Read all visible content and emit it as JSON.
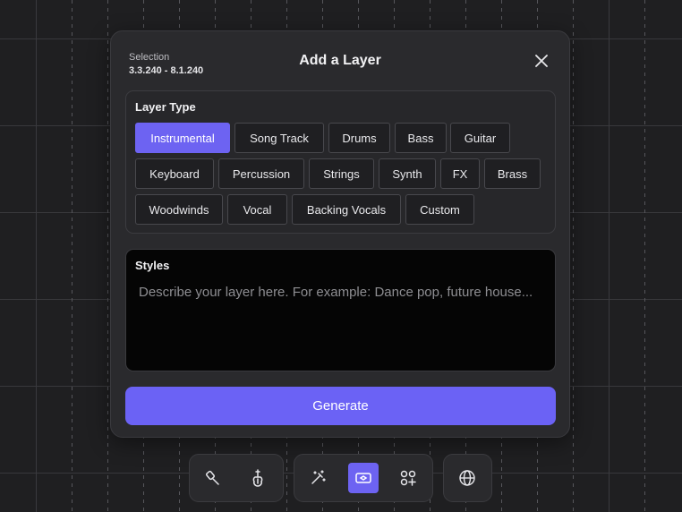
{
  "dialog": {
    "selection_label": "Selection",
    "selection_range": "3.3.240 - 8.1.240",
    "title": "Add a Layer",
    "close_icon": "close-icon"
  },
  "layer_type": {
    "label": "Layer Type",
    "selected": "Instrumental",
    "options": [
      "Instrumental",
      "Song Track",
      "Drums",
      "Bass",
      "Guitar",
      "Keyboard",
      "Percussion",
      "Strings",
      "Synth",
      "FX",
      "Brass",
      "Woodwinds",
      "Vocal",
      "Backing Vocals",
      "Custom"
    ]
  },
  "styles": {
    "label": "Styles",
    "placeholder": "Describe your layer here. For example: Dance pop, future house...",
    "value": ""
  },
  "generate_label": "Generate",
  "toolbar": {
    "groups": [
      {
        "buttons": [
          {
            "icon": "brush-icon"
          },
          {
            "icon": "guitar-tuner-icon"
          }
        ]
      },
      {
        "buttons": [
          {
            "icon": "magic-wand-icon"
          },
          {
            "icon": "add-layer-icon",
            "active": true
          },
          {
            "icon": "shapes-add-icon"
          }
        ]
      },
      {
        "buttons": [
          {
            "icon": "globe-icon"
          }
        ]
      }
    ]
  },
  "colors": {
    "accent": "#6d63f2",
    "background": "#1f1f21",
    "dialog": "#2a2a2d"
  }
}
